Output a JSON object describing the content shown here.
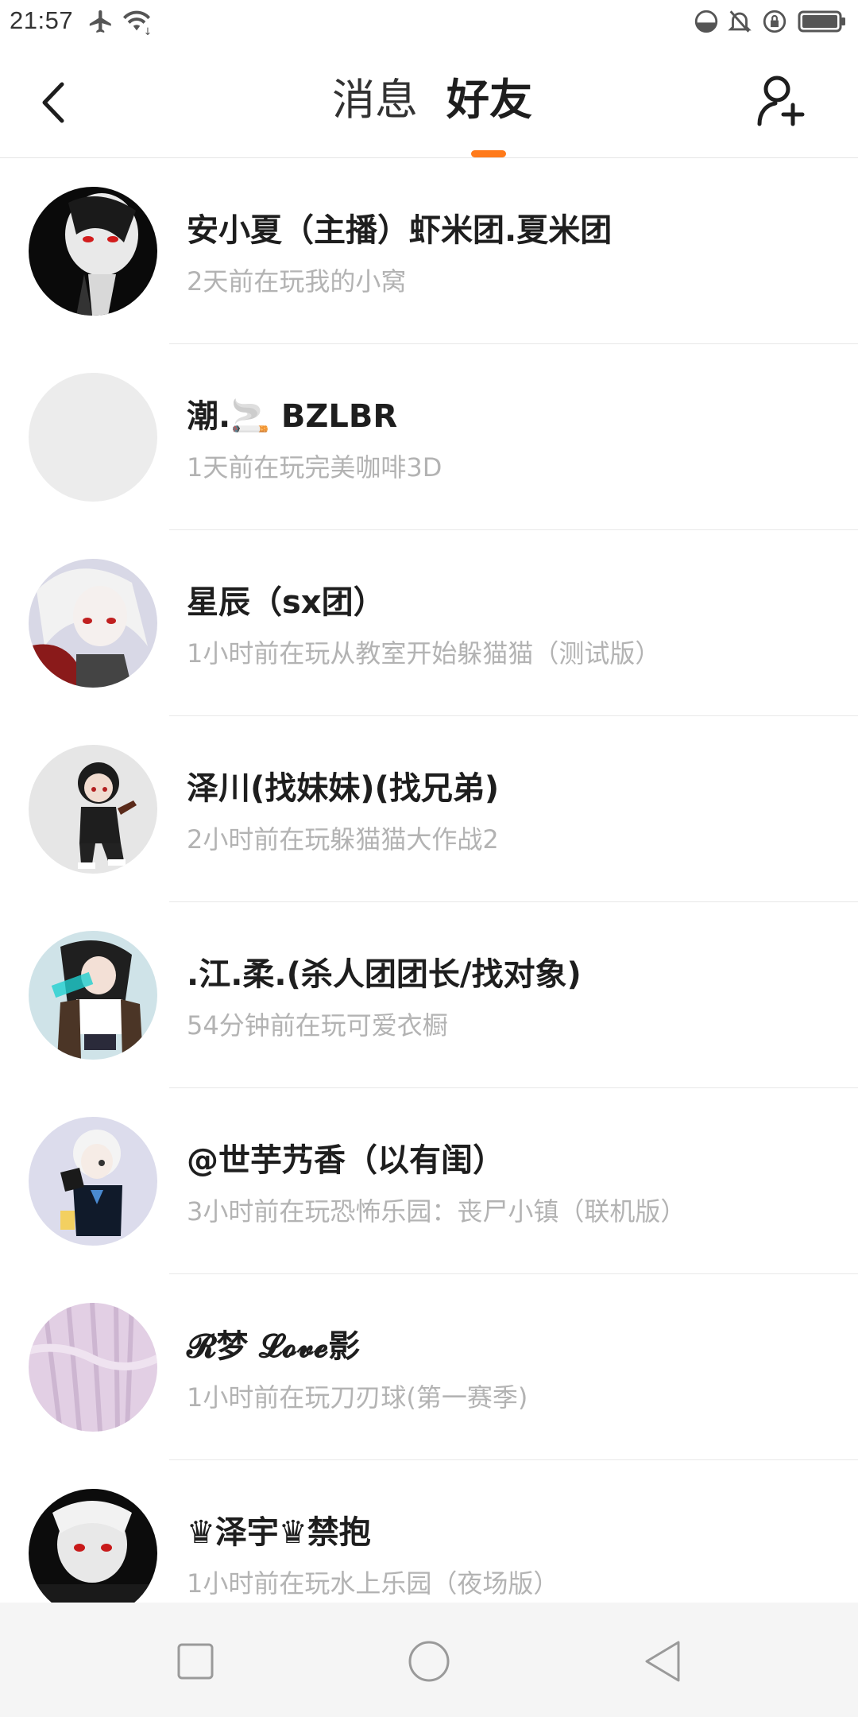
{
  "status_bar": {
    "time": "21:57",
    "icons": [
      "airplane-icon",
      "wifi-icon",
      "data-saver-icon",
      "mute-icon",
      "lock-rotation-icon",
      "battery-icon"
    ]
  },
  "header": {
    "tabs": [
      {
        "label": "消息",
        "active": false
      },
      {
        "label": "好友",
        "active": true
      }
    ],
    "accent_color": "#ff7a1a",
    "back_icon": "chevron-left-icon",
    "add_icon": "add-friend-icon"
  },
  "friends": [
    {
      "name": "安小夏（主播）虾米团.夏米团",
      "status": "2天前在玩我的小窝",
      "avatar": "avatar-dark"
    },
    {
      "name": "潮.🚬 BZLBR",
      "status": "1天前在玩完美咖啡3D",
      "avatar": "avatar-empty"
    },
    {
      "name": "星辰（sx团）",
      "status": "1小时前在玩从教室开始躲猫猫（测试版）",
      "avatar": "avatar-white-hair"
    },
    {
      "name": "泽川(找妹妹)(找兄弟)",
      "status": "2小时前在玩躲猫猫大作战2",
      "avatar": "avatar-chibi"
    },
    {
      "name": ".江.柔.(杀人团团长/找对象)",
      "status": "54分钟前在玩可爱衣橱",
      "avatar": "avatar-girl"
    },
    {
      "name": "@世芋艿香（以有闺）",
      "status": "3小时前在玩恐怖乐园：丧尸小镇（联机版）",
      "avatar": "avatar-silver"
    },
    {
      "name": "𝓡梦  𝓛𝓸𝓿𝓮影",
      "status": "1小时前在玩刀刃球(第一赛季)",
      "avatar": "avatar-pink"
    },
    {
      "name": "♛泽宇♛禁抱",
      "status": "1小时前在玩水上乐园（夜场版）",
      "avatar": "avatar-dark-red"
    }
  ],
  "nav_bar": {
    "buttons": [
      "recents-square-icon",
      "home-circle-icon",
      "back-triangle-icon"
    ]
  }
}
